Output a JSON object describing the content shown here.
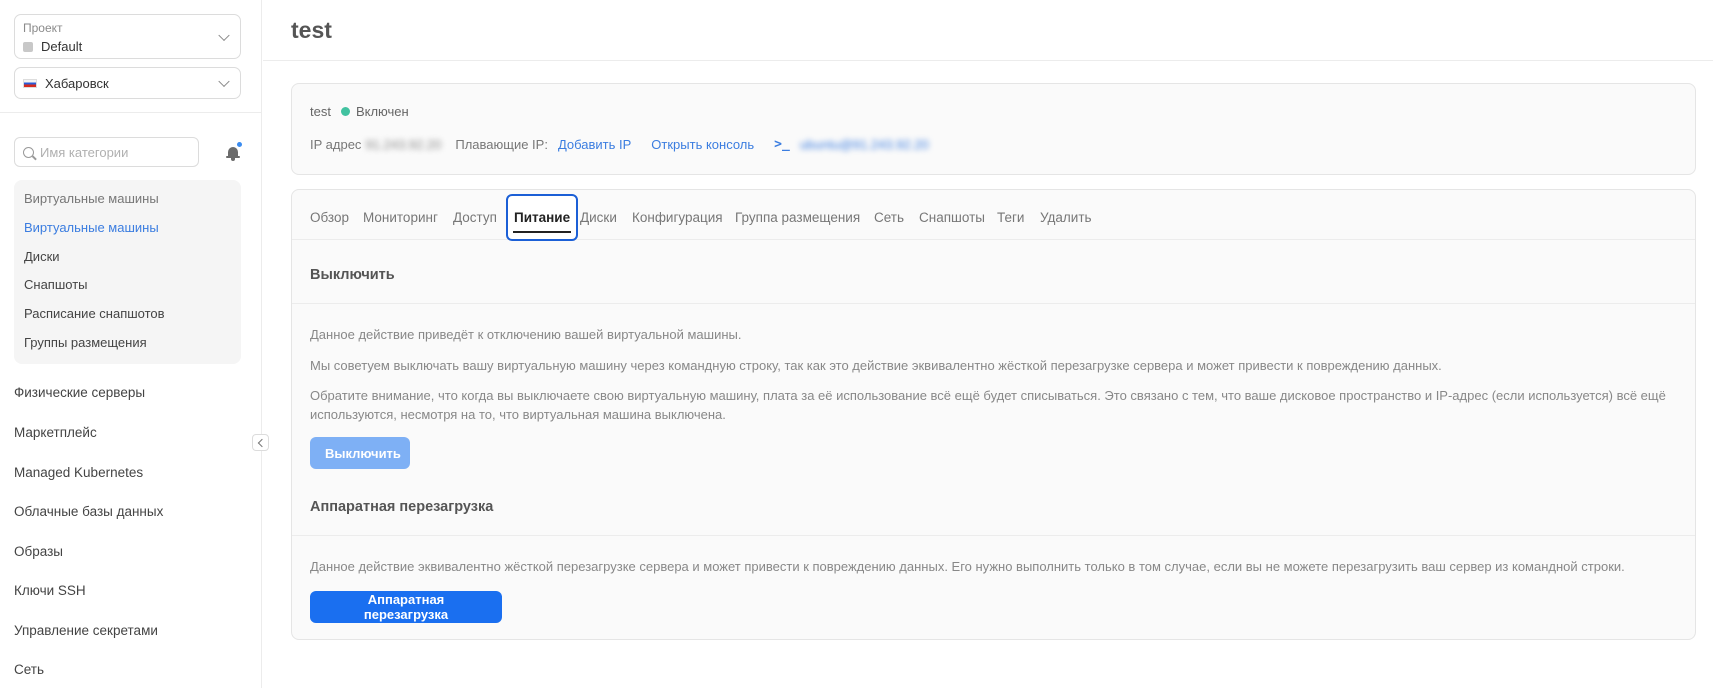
{
  "sidebar": {
    "project_caption": "Проект",
    "project_value": "Default",
    "region_value": "Хабаровск",
    "search_placeholder": "Имя категории",
    "categories": [
      {
        "label": "Виртуальные машины"
      },
      {
        "label": "Виртуальные машины"
      },
      {
        "label": "Диски"
      },
      {
        "label": "Снапшоты"
      },
      {
        "label": "Расписание снапшотов"
      },
      {
        "label": "Группы размещения"
      }
    ],
    "nav": [
      {
        "label": "Физические серверы"
      },
      {
        "label": "Маркетплейс"
      },
      {
        "label": "Managed Kubernetes"
      },
      {
        "label": "Облачные базы данных"
      },
      {
        "label": "Образы"
      },
      {
        "label": "Ключи SSH"
      },
      {
        "label": "Управление секретами"
      },
      {
        "label": "Сеть"
      }
    ]
  },
  "page": {
    "title": "test"
  },
  "info": {
    "name": "test",
    "status": "Включен",
    "ip_label": "IP адрес",
    "ip_value": "91.243.92.20",
    "floating_label": "Плавающие IP:",
    "add_ip": "Добавить IP",
    "open_console": "Открыть консоль",
    "terminal_glyph": ">_",
    "ssh_value": "ubuntu@91.243.92.20"
  },
  "tabs": [
    {
      "label": "Обзор"
    },
    {
      "label": "Мониторинг"
    },
    {
      "label": "Доступ"
    },
    {
      "label": "Питание"
    },
    {
      "label": "Диски"
    },
    {
      "label": "Конфигурация"
    },
    {
      "label": "Группа размещения"
    },
    {
      "label": "Сеть"
    },
    {
      "label": "Снапшоты"
    },
    {
      "label": "Теги"
    },
    {
      "label": "Удалить"
    }
  ],
  "shutdown": {
    "title": "Выключить",
    "p1": "Данное действие приведёт к отключению вашей виртуальной машины.",
    "p2": "Мы советуем выключать вашу виртуальную машину через командную строку, так как это действие эквивалентно жёсткой перезагрузке сервера и может привести к повреждению данных.",
    "p3": "Обратите внимание, что когда вы выключаете свою виртуальную машину, плата за её использование всё ещё будет списываться. Это связано с тем, что ваше дисковое пространство и IP-адрес (если используется) всё ещё используются, несмотря на то, что виртуальная машина выключена.",
    "button": "Выключить"
  },
  "reboot": {
    "title": "Аппаратная перезагрузка",
    "p1": "Данное действие эквивалентно жёсткой перезагрузке сервера и может привести к повреждению данных. Его нужно выполнить только в том случае, если вы не можете перезагрузить ваш сервер из командной строки.",
    "button": "Аппаратная перезагрузка"
  },
  "colors": {
    "accent": "#1a6ff0",
    "accent_light": "#7eb0f5",
    "link": "#3b7de0",
    "status_on": "#41c2a0",
    "notification": "#3b8cf0"
  }
}
